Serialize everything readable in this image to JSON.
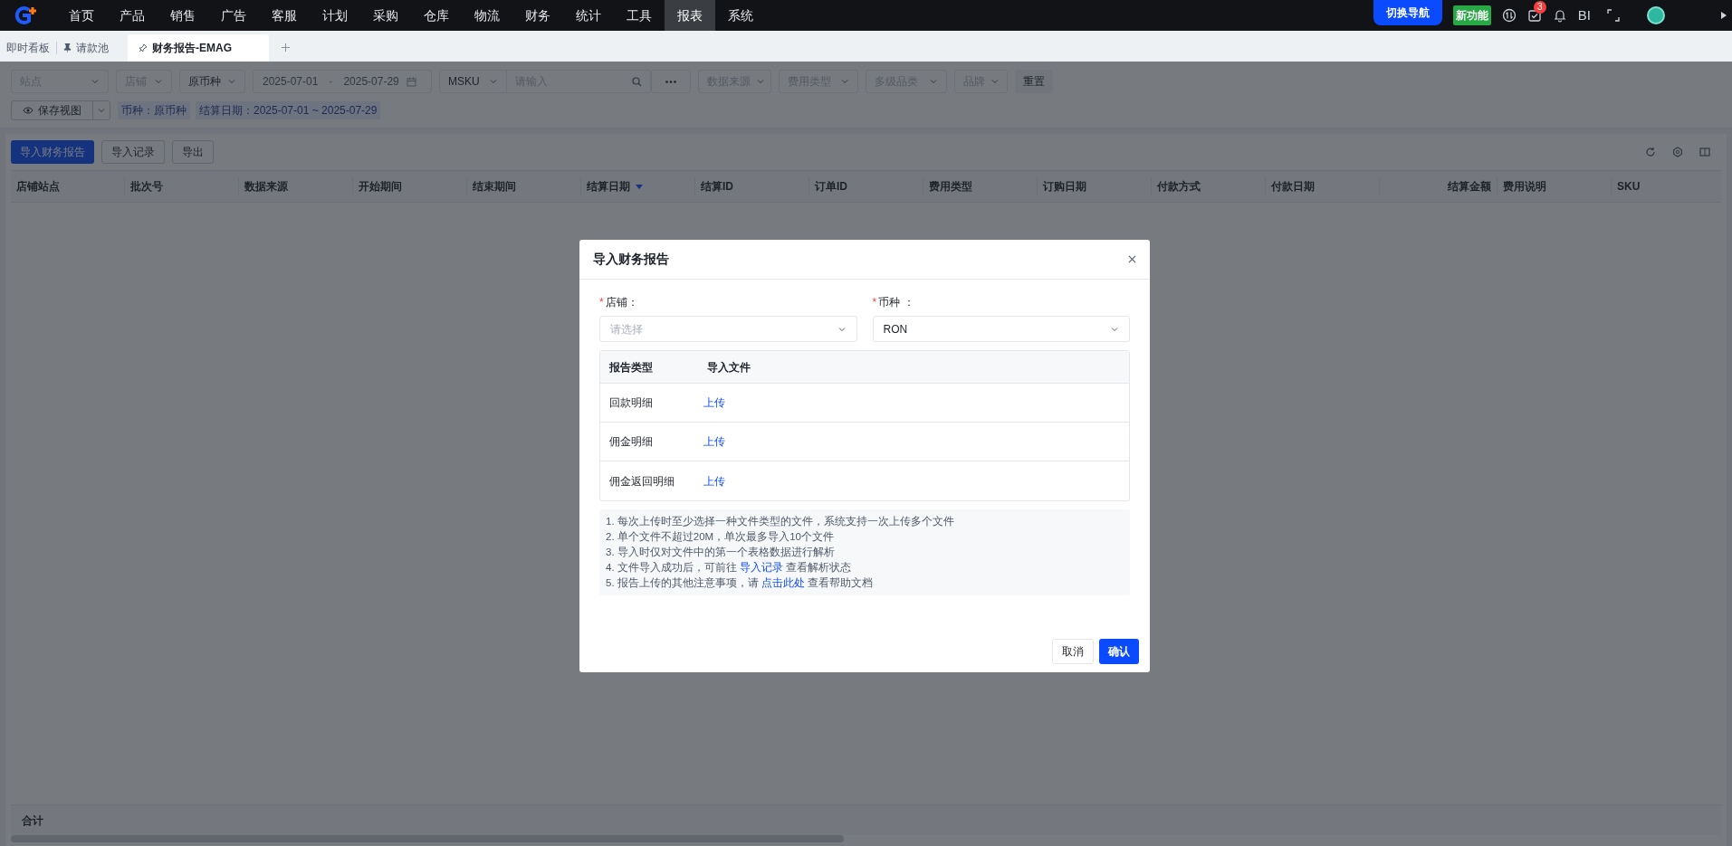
{
  "nav": {
    "items": [
      {
        "label": "首页",
        "selected": false
      },
      {
        "label": "产品",
        "selected": false
      },
      {
        "label": "销售",
        "selected": false
      },
      {
        "label": "广告",
        "selected": false
      },
      {
        "label": "客服",
        "selected": false
      },
      {
        "label": "计划",
        "selected": false
      },
      {
        "label": "采购",
        "selected": false
      },
      {
        "label": "仓库",
        "selected": false
      },
      {
        "label": "物流",
        "selected": false
      },
      {
        "label": "财务",
        "selected": false
      },
      {
        "label": "统计",
        "selected": false
      },
      {
        "label": "工具",
        "selected": false
      },
      {
        "label": "报表",
        "selected": true
      },
      {
        "label": "系统",
        "selected": false
      }
    ],
    "switch_button": "切换导航",
    "new_feature": "新功能",
    "task_badge": "3",
    "bi": "BI"
  },
  "tabs": [
    {
      "label": "即时看板",
      "kind": "plain",
      "selected": false
    },
    {
      "label": "请款池",
      "kind": "pinned",
      "selected": false
    },
    {
      "label": "财务报告-EMAG",
      "kind": "pin",
      "selected": true
    }
  ],
  "filters": [
    {
      "kind": "select",
      "text": "站点",
      "placeholder": true
    },
    {
      "kind": "select",
      "text": "店铺",
      "placeholder": true
    },
    {
      "kind": "select",
      "text": "原币种",
      "placeholder": false
    },
    {
      "kind": "daterange",
      "start": "2025-07-01",
      "separator": "-",
      "end": "2025-07-29"
    },
    {
      "kind": "search",
      "field": "MSKU",
      "placeholder": "请输入"
    },
    {
      "kind": "select",
      "text": "数据来源",
      "placeholder": true
    },
    {
      "kind": "select",
      "text": "费用类型",
      "placeholder": true
    },
    {
      "kind": "select",
      "text": "多级品类",
      "placeholder": true
    },
    {
      "kind": "select",
      "text": "品牌",
      "placeholder": true
    }
  ],
  "reset_button": "重置",
  "save_view": "保存视图",
  "chips": [
    "币种：原币种",
    "结算日期：2025-07-01 ~ 2025-07-29"
  ],
  "toolbar": [
    {
      "label": "导入财务报告",
      "kind": "primary"
    },
    {
      "label": "导入记录",
      "kind": "default"
    },
    {
      "label": "导出",
      "kind": "default"
    }
  ],
  "table": {
    "columns": [
      {
        "label": "店铺站点",
        "sorted": false
      },
      {
        "label": "批次号",
        "sorted": false
      },
      {
        "label": "数据来源",
        "sorted": false
      },
      {
        "label": "开始期间",
        "sorted": false
      },
      {
        "label": "结束期间",
        "sorted": false
      },
      {
        "label": "结算日期",
        "sorted": true
      },
      {
        "label": "结算ID",
        "sorted": false
      },
      {
        "label": "订单ID",
        "sorted": false
      },
      {
        "label": "费用类型",
        "sorted": false
      },
      {
        "label": "订购日期",
        "sorted": false
      },
      {
        "label": "付款方式",
        "sorted": false
      },
      {
        "label": "付款日期",
        "sorted": false
      },
      {
        "label": "结算金额",
        "sorted": false
      },
      {
        "label": "费用说明",
        "sorted": false
      },
      {
        "label": "SKU",
        "sorted": false
      }
    ],
    "footer": "合计"
  },
  "modal": {
    "title": "导入财务报告",
    "fields": [
      {
        "required_mark": "*",
        "label": "店铺：",
        "placeholder": "请选择"
      },
      {
        "required_mark": "*",
        "label": "币种 ：",
        "value": "RON"
      }
    ],
    "report_table": {
      "columns": [
        "报告类型",
        "导入文件"
      ],
      "rows": [
        {
          "type": "回款明细",
          "action": "上传"
        },
        {
          "type": "佣金明细",
          "action": "上传"
        },
        {
          "type": "佣金返回明细",
          "action": "上传"
        }
      ]
    },
    "notes": [
      {
        "before": "1. 每次上传时至少选择一种文件类型的文件，系统支持一次上传多个文件"
      },
      {
        "before": "2. 单个文件不超过20M，单次最多导入10个文件"
      },
      {
        "before": "3. 导入时仅对文件中的第一个表格数据进行解析"
      },
      {
        "before": "4. 文件导入成功后，可前往",
        "link": "导入记录",
        "after": "查看解析状态"
      },
      {
        "before": "5. 报告上传的其他注意事项，请",
        "link": "点击此处",
        "after": "查看帮助文档"
      }
    ],
    "buttons": [
      {
        "label": "取消",
        "kind": "default"
      },
      {
        "label": "确认",
        "kind": "primary"
      }
    ]
  }
}
